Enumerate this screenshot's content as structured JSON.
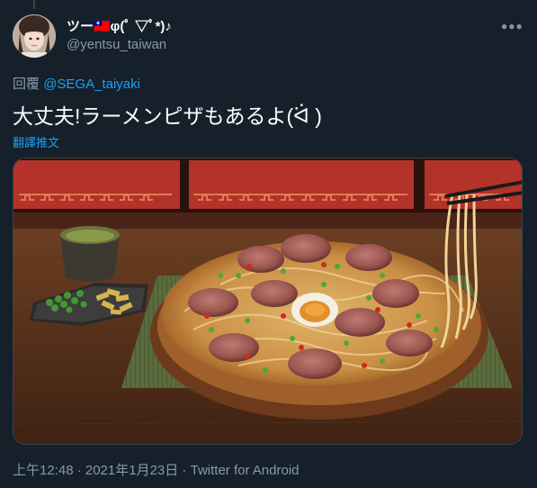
{
  "tweet": {
    "author": {
      "display_name": "ツー🇹🇼φ(ﾟ ▽ﾟ*)♪",
      "handle": "@yentsu_taiwan"
    },
    "more_icon": "more-horizontal-icon",
    "reply_prefix": "回覆",
    "reply_mention": "@SEGA_taiyaki",
    "text": "大丈夫!ラーメンピザもあるよ(ᐛ )",
    "translate_label": "翻譯推文",
    "timestamp": "上午12:48 · 2021年1月23日",
    "separator": " · ",
    "source_app": "Twitter for Android"
  },
  "colors": {
    "background": "#15202b",
    "text_primary": "#ffffff",
    "text_secondary": "#8899a6",
    "accent": "#1da1f2",
    "border": "#38444d"
  }
}
